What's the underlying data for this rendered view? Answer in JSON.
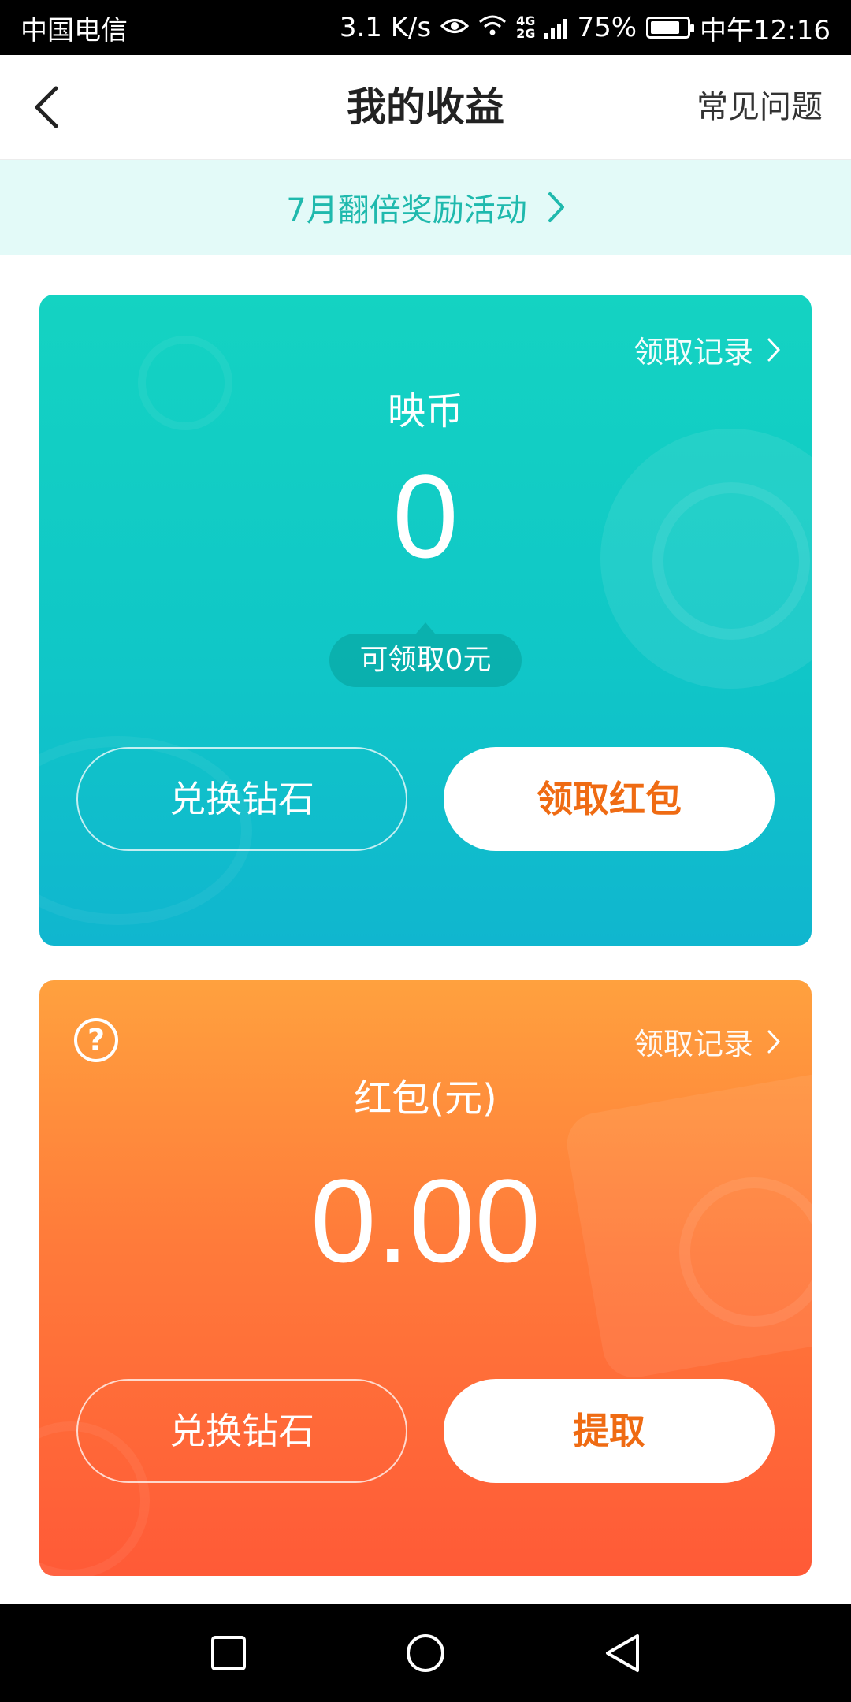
{
  "status_bar": {
    "carrier": "中国电信",
    "net_speed": "3.1 K/s",
    "net_type_top": "4G",
    "net_type_bottom": "2G",
    "battery": "75%",
    "time": "中午12:16"
  },
  "header": {
    "title": "我的收益",
    "faq": "常见问题"
  },
  "banner": {
    "text": "7月翻倍奖励活动"
  },
  "coin_card": {
    "record_link": "领取记录",
    "label": "映币",
    "amount": "0",
    "claimable": "可领取0元",
    "exchange_button": "兑换钻石",
    "claim_button": "领取红包"
  },
  "red_packet_card": {
    "help": "?",
    "record_link": "领取记录",
    "label": "红包(元)",
    "amount": "0.00",
    "exchange_button": "兑换钻石",
    "withdraw_button": "提取"
  },
  "colors": {
    "accent_teal": "#14d3c2",
    "accent_orange": "#ff7a3a",
    "button_text_orange": "#ef6b13"
  }
}
